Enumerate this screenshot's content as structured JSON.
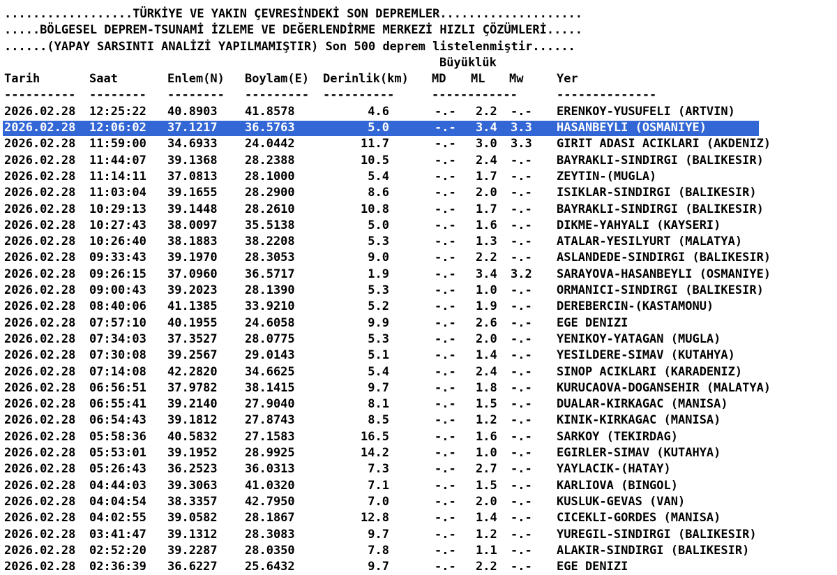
{
  "header": {
    "line1": "..................TÜRKİYE VE YAKIN ÇEVRESİNDEKİ SON DEPREMLER....................",
    "line2": ".....BÖLGESEL DEPREM-TSUNAMİ İZLEME VE DEĞERLENDİRME MERKEZİ HIZLI ÇÖZÜMLERİ.....",
    "line3": "......(YAPAY SARSINTI ANALİZİ YAPILMAMIŞTIR) Son 500 deprem listelenmiştir......"
  },
  "columns": {
    "magnitude_group": "Büyüklük",
    "tarih": "Tarih",
    "saat": "Saat",
    "enlem": "Enlem(N)",
    "boylam": "Boylam(E)",
    "derinlik": "Derinlik(km)",
    "md": "MD",
    "ml": "ML",
    "mw": "Mw",
    "yer": "Yer"
  },
  "separators": {
    "tarih": "----------",
    "saat": "--------",
    "enlem": "--------",
    "boylam": "---------",
    "derinlik": "----------",
    "mag": "------------",
    "yer": "--------------"
  },
  "selected_index": 1,
  "rows": [
    {
      "tarih": "2026.02.28",
      "saat": "12:25:22",
      "enlem": "40.8903",
      "boylam": "41.8578",
      "derinlik": "4.6",
      "md": "-.-",
      "ml": "2.2",
      "mw": "-.-",
      "yer": "ERENKOY-YUSUFELI (ARTVIN)"
    },
    {
      "tarih": "2026.02.28",
      "saat": "12:06:02",
      "enlem": "37.1217",
      "boylam": "36.5763",
      "derinlik": "5.0",
      "md": "-.-",
      "ml": "3.4",
      "mw": "3.3",
      "yer": "HASANBEYLI (OSMANIYE)"
    },
    {
      "tarih": "2026.02.28",
      "saat": "11:59:00",
      "enlem": "34.6933",
      "boylam": "24.0442",
      "derinlik": "11.7",
      "md": "-.-",
      "ml": "3.0",
      "mw": "3.3",
      "yer": "GIRIT ADASI ACIKLARI (AKDENIZ)"
    },
    {
      "tarih": "2026.02.28",
      "saat": "11:44:07",
      "enlem": "39.1368",
      "boylam": "28.2388",
      "derinlik": "10.5",
      "md": "-.-",
      "ml": "2.4",
      "mw": "-.-",
      "yer": "BAYRAKLI-SINDIRGI (BALIKESIR)"
    },
    {
      "tarih": "2026.02.28",
      "saat": "11:14:11",
      "enlem": "37.0813",
      "boylam": "28.1000",
      "derinlik": "5.4",
      "md": "-.-",
      "ml": "1.7",
      "mw": "-.-",
      "yer": "ZEYTIN-(MUGLA)"
    },
    {
      "tarih": "2026.02.28",
      "saat": "11:03:04",
      "enlem": "39.1655",
      "boylam": "28.2900",
      "derinlik": "8.6",
      "md": "-.-",
      "ml": "2.0",
      "mw": "-.-",
      "yer": "ISIKLAR-SINDIRGI (BALIKESIR)"
    },
    {
      "tarih": "2026.02.28",
      "saat": "10:29:13",
      "enlem": "39.1448",
      "boylam": "28.2610",
      "derinlik": "10.8",
      "md": "-.-",
      "ml": "1.7",
      "mw": "-.-",
      "yer": "BAYRAKLI-SINDIRGI (BALIKESIR)"
    },
    {
      "tarih": "2026.02.28",
      "saat": "10:27:43",
      "enlem": "38.0097",
      "boylam": "35.5138",
      "derinlik": "5.0",
      "md": "-.-",
      "ml": "1.6",
      "mw": "-.-",
      "yer": "DIKME-YAHYALI (KAYSERI)"
    },
    {
      "tarih": "2026.02.28",
      "saat": "10:26:40",
      "enlem": "38.1883",
      "boylam": "38.2208",
      "derinlik": "5.3",
      "md": "-.-",
      "ml": "1.3",
      "mw": "-.-",
      "yer": "ATALAR-YESILYURT (MALATYA)"
    },
    {
      "tarih": "2026.02.28",
      "saat": "09:33:43",
      "enlem": "39.1970",
      "boylam": "28.3053",
      "derinlik": "9.0",
      "md": "-.-",
      "ml": "2.2",
      "mw": "-.-",
      "yer": "ASLANDEDE-SINDIRGI (BALIKESIR)"
    },
    {
      "tarih": "2026.02.28",
      "saat": "09:26:15",
      "enlem": "37.0960",
      "boylam": "36.5717",
      "derinlik": "1.9",
      "md": "-.-",
      "ml": "3.4",
      "mw": "3.2",
      "yer": "SARAYOVA-HASANBEYLI (OSMANIYE)"
    },
    {
      "tarih": "2026.02.28",
      "saat": "09:00:43",
      "enlem": "39.2023",
      "boylam": "28.1390",
      "derinlik": "5.3",
      "md": "-.-",
      "ml": "1.0",
      "mw": "-.-",
      "yer": "ORMANICI-SINDIRGI (BALIKESIR)"
    },
    {
      "tarih": "2026.02.28",
      "saat": "08:40:06",
      "enlem": "41.1385",
      "boylam": "33.9210",
      "derinlik": "5.2",
      "md": "-.-",
      "ml": "1.9",
      "mw": "-.-",
      "yer": "DEREBERCIN-(KASTAMONU)"
    },
    {
      "tarih": "2026.02.28",
      "saat": "07:57:10",
      "enlem": "40.1955",
      "boylam": "24.6058",
      "derinlik": "9.9",
      "md": "-.-",
      "ml": "2.6",
      "mw": "-.-",
      "yer": "EGE DENIZI"
    },
    {
      "tarih": "2026.02.28",
      "saat": "07:34:03",
      "enlem": "37.3527",
      "boylam": "28.0775",
      "derinlik": "5.3",
      "md": "-.-",
      "ml": "2.0",
      "mw": "-.-",
      "yer": "YENIKOY-YATAGAN (MUGLA)"
    },
    {
      "tarih": "2026.02.28",
      "saat": "07:30:08",
      "enlem": "39.2567",
      "boylam": "29.0143",
      "derinlik": "5.1",
      "md": "-.-",
      "ml": "1.4",
      "mw": "-.-",
      "yer": "YESILDERE-SIMAV (KUTAHYA)"
    },
    {
      "tarih": "2026.02.28",
      "saat": "07:14:08",
      "enlem": "42.2820",
      "boylam": "34.6625",
      "derinlik": "5.4",
      "md": "-.-",
      "ml": "2.4",
      "mw": "-.-",
      "yer": "SINOP ACIKLARI (KARADENIZ)"
    },
    {
      "tarih": "2026.02.28",
      "saat": "06:56:51",
      "enlem": "37.9782",
      "boylam": "38.1415",
      "derinlik": "9.7",
      "md": "-.-",
      "ml": "1.8",
      "mw": "-.-",
      "yer": "KURUCAOVA-DOGANSEHIR (MALATYA)"
    },
    {
      "tarih": "2026.02.28",
      "saat": "06:55:41",
      "enlem": "39.2140",
      "boylam": "27.9040",
      "derinlik": "8.1",
      "md": "-.-",
      "ml": "1.5",
      "mw": "-.-",
      "yer": "DUALAR-KIRKAGAC (MANISA)"
    },
    {
      "tarih": "2026.02.28",
      "saat": "06:54:43",
      "enlem": "39.1812",
      "boylam": "27.8743",
      "derinlik": "8.5",
      "md": "-.-",
      "ml": "1.2",
      "mw": "-.-",
      "yer": "KINIK-KIRKAGAC (MANISA)"
    },
    {
      "tarih": "2026.02.28",
      "saat": "05:58:36",
      "enlem": "40.5832",
      "boylam": "27.1583",
      "derinlik": "16.5",
      "md": "-.-",
      "ml": "1.6",
      "mw": "-.-",
      "yer": "SARKOY (TEKIRDAG)"
    },
    {
      "tarih": "2026.02.28",
      "saat": "05:53:01",
      "enlem": "39.1952",
      "boylam": "28.9925",
      "derinlik": "14.2",
      "md": "-.-",
      "ml": "1.0",
      "mw": "-.-",
      "yer": "EGIRLER-SIMAV (KUTAHYA)"
    },
    {
      "tarih": "2026.02.28",
      "saat": "05:26:43",
      "enlem": "36.2523",
      "boylam": "36.0313",
      "derinlik": "7.3",
      "md": "-.-",
      "ml": "2.7",
      "mw": "-.-",
      "yer": "YAYLACIK-(HATAY)"
    },
    {
      "tarih": "2026.02.28",
      "saat": "04:44:03",
      "enlem": "39.3063",
      "boylam": "41.0320",
      "derinlik": "7.1",
      "md": "-.-",
      "ml": "1.5",
      "mw": "-.-",
      "yer": "KARLIOVA (BINGOL)"
    },
    {
      "tarih": "2026.02.28",
      "saat": "04:04:54",
      "enlem": "38.3357",
      "boylam": "42.7950",
      "derinlik": "7.0",
      "md": "-.-",
      "ml": "2.0",
      "mw": "-.-",
      "yer": "KUSLUK-GEVAS (VAN)"
    },
    {
      "tarih": "2026.02.28",
      "saat": "04:02:55",
      "enlem": "39.0582",
      "boylam": "28.1867",
      "derinlik": "12.8",
      "md": "-.-",
      "ml": "1.4",
      "mw": "-.-",
      "yer": "CICEKLI-GORDES (MANISA)"
    },
    {
      "tarih": "2026.02.28",
      "saat": "03:41:47",
      "enlem": "39.1312",
      "boylam": "28.3083",
      "derinlik": "9.7",
      "md": "-.-",
      "ml": "1.2",
      "mw": "-.-",
      "yer": "YUREGIL-SINDIRGI (BALIKESIR)"
    },
    {
      "tarih": "2026.02.28",
      "saat": "02:52:20",
      "enlem": "39.2287",
      "boylam": "28.0350",
      "derinlik": "7.8",
      "md": "-.-",
      "ml": "1.1",
      "mw": "-.-",
      "yer": "ALAKIR-SINDIRGI (BALIKESIR)"
    },
    {
      "tarih": "2026.02.28",
      "saat": "02:36:39",
      "enlem": "36.6227",
      "boylam": "25.6432",
      "derinlik": "9.7",
      "md": "-.-",
      "ml": "2.2",
      "mw": "-.-",
      "yer": "EGE DENIZI"
    }
  ]
}
